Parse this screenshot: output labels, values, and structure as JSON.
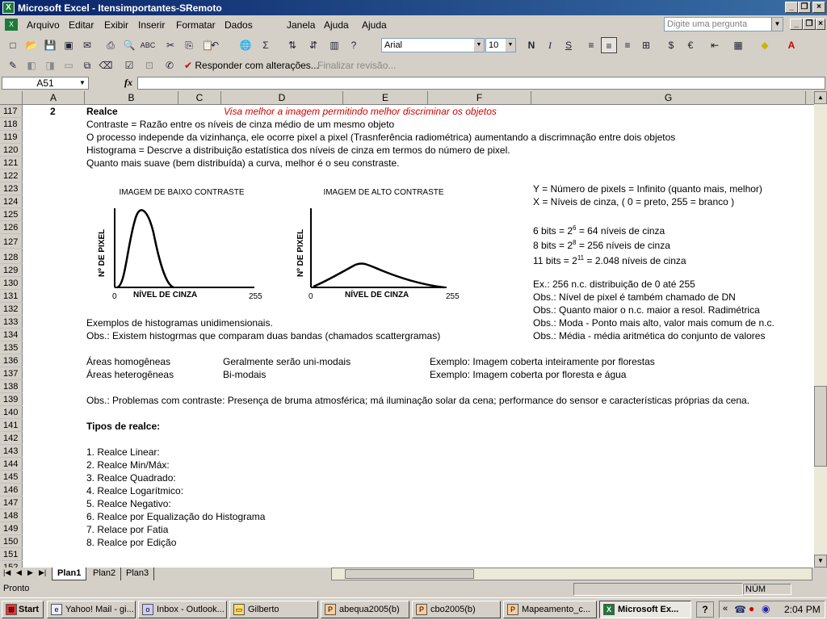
{
  "window": {
    "title": "Microsoft Excel - Itensimportantes-SRemoto",
    "app_icon": "excel-icon"
  },
  "menu": {
    "items": [
      "Arquivo",
      "Editar",
      "Exibir",
      "Inserir",
      "Formatar",
      "Dados",
      "Janela",
      "Ajuda"
    ],
    "ask_placeholder": "Digite uma pergunta"
  },
  "toolbar": {
    "font_name": "Arial",
    "font_size": "10",
    "reply_label": "Responder com alterações...",
    "finalize_label": "Finalizar revisão..."
  },
  "formula": {
    "name_box": "A51",
    "fx": "fx",
    "value": ""
  },
  "columns": [
    "A",
    "B",
    "C",
    "D",
    "E",
    "F",
    "G"
  ],
  "rows": [
    "117",
    "118",
    "119",
    "120",
    "121",
    "122",
    "123",
    "124",
    "125",
    "126",
    "127",
    "128",
    "129",
    "130",
    "131",
    "132",
    "133",
    "134",
    "135",
    "136",
    "137",
    "138",
    "139",
    "140",
    "141",
    "142",
    "143",
    "144",
    "145",
    "146",
    "147",
    "148",
    "149",
    "150",
    "151",
    "152"
  ],
  "cells": {
    "r117_a": "2",
    "r117_b": "Realce",
    "r117_d": "Visa melhor a imagem permitindo melhor discriminar os objetos",
    "r118": "Contraste = Razão entre os níveis de cinza médio de um mesmo objeto",
    "r119": "O processo independe da vizinhança, ele ocorre pixel a pixel (Trasnferência radiométrica) aumentando a discrimnação entre dois objetos",
    "r120": "Histograma = Descrve a distribuição estatística dos níveis de cinza em termos do número de pixel.",
    "r121": "Quanto mais suave (bem distribuída) a curva, melhor é o seu constraste.",
    "r123_g": "Y = Número de pixels = Infinito (quanto mais, melhor)",
    "r124_g": "X = Níveis de cinza, ( 0 = preto, 255 = branco )",
    "r126_a": "6   bits = 2",
    "r126_sup": "6",
    "r126_b": " = 64 níveis de cinza",
    "r127_a": "8   bits = 2",
    "r127_sup": "8",
    "r127_b": " = 256 níveis de cinza",
    "r128_a": "11 bits = 2",
    "r128_sup": "11",
    "r128_b": " = 2.048 níveis de cinza",
    "r130_g": "Ex.: 256 n.c. distribuição de 0 até 255",
    "r131_g": "Obs.: Nível de pixel é também chamado de DN",
    "r132_g": "Obs.: Quanto maior o n.c. maior a resol. Radimétrica",
    "r133_b": "Exemplos de histogramas unidimensionais.",
    "r133_g": "Obs.: Moda - Ponto mais alto, valor mais comum de n.c.",
    "r134_b": "Obs.: Existem histogrmas que comparam duas bandas (chamados scattergramas)",
    "r134_g": "Obs.: Média - média aritmética do conjunto de valores",
    "r136_b": "Áreas homogêneas",
    "r136_d": "Geralmente serão uni-modais",
    "r136_f": "Exemplo: Imagem coberta inteiramente por florestas",
    "r137_b": "Áreas heterogêneas",
    "r137_d": "Bi-modais",
    "r137_f": "Exemplo: Imagem coberta por floresta e água",
    "r139": "Obs.: Problemas com contraste: Presença de bruma atmosférica; má iluminação solar da cena; performance do sensor e características próprias da cena.",
    "r141": "Tipos de realce:",
    "r143": "1. Realce Linear:",
    "r144": "2. Realce Min/Máx:",
    "r145": "3. Realce Quadrado:",
    "r146": "4. Realce Logarítmico:",
    "r147": "5. Realce Negativo:",
    "r148": "6. Realce por Equalização do Histograma",
    "r149": "7. Relace por Fatia",
    "r150": "8. Realce por Edição"
  },
  "figures": {
    "low": {
      "title": "IMAGEM DE BAIXO CONTRASTE",
      "ylabel": "Nº DE PIXEL",
      "xlabel": "NÍVEL DE CINZA",
      "xmin": "0",
      "xmax": "255"
    },
    "high": {
      "title": "IMAGEM DE ALTO CONTRASTE",
      "ylabel": "Nº DE PIXEL",
      "xlabel": "NÍVEL DE CINZA",
      "xmin": "0",
      "xmax": "255"
    }
  },
  "sheets": {
    "tabs": [
      "Plan1",
      "Plan2",
      "Plan3"
    ],
    "active": "Plan1"
  },
  "status": {
    "left": "Pronto",
    "num": "NÚM"
  },
  "taskbar": {
    "start": "Start",
    "tasks": [
      "Yahoo! Mail - gi...",
      "Inbox - Outlook...",
      "Gilberto",
      "abequa2005(b)",
      "cbo2005(b)",
      "Mapeamento_c...",
      "Microsoft Ex..."
    ],
    "time": "2:04 PM"
  }
}
